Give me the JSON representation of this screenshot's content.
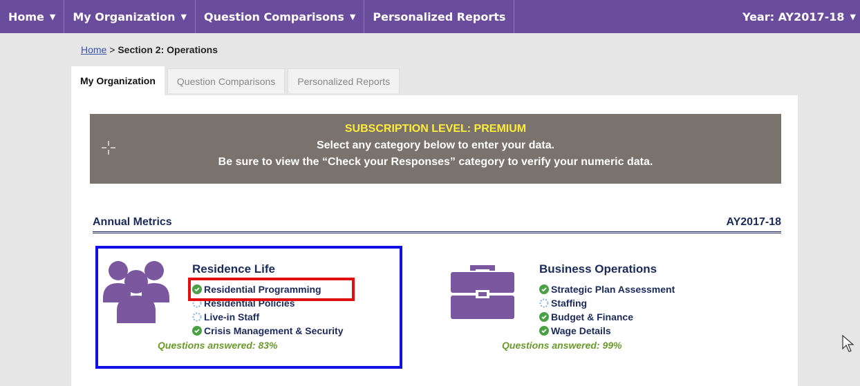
{
  "nav": {
    "home": "Home",
    "my_org": "My Organization",
    "question_comparisons": "Question Comparisons",
    "personalized_reports": "Personalized Reports",
    "year": "Year: AY2017-18"
  },
  "breadcrumb": {
    "home": "Home",
    "separator": ">",
    "current": "Section 2: Operations"
  },
  "tabs": [
    {
      "label": "My Organization",
      "active": true
    },
    {
      "label": "Question Comparisons",
      "active": false
    },
    {
      "label": "Personalized Reports",
      "active": false
    }
  ],
  "banner": {
    "level": "SUBSCRIPTION LEVEL: PREMIUM",
    "line1": "Select any category below to enter your data.",
    "line2": "Be sure to view the “Check your Responses” category to verify your numeric data."
  },
  "metrics": {
    "title": "Annual Metrics",
    "year": "AY2017-18"
  },
  "categories": [
    {
      "title": "Residence Life",
      "icon": "people-group-icon",
      "items": [
        {
          "label": "Residential Programming",
          "status": "complete"
        },
        {
          "label": "Residential Policies",
          "status": "in-progress"
        },
        {
          "label": "Live-in Staff",
          "status": "in-progress"
        },
        {
          "label": "Crisis Management & Security",
          "status": "complete"
        }
      ],
      "answered": "Questions answered: 83%"
    },
    {
      "title": "Business Operations",
      "icon": "briefcase-icon",
      "items": [
        {
          "label": "Strategic Plan Assessment",
          "status": "complete"
        },
        {
          "label": "Staffing",
          "status": "in-progress"
        },
        {
          "label": "Budget & Finance",
          "status": "complete"
        },
        {
          "label": "Wage Details",
          "status": "complete"
        }
      ],
      "answered": "Questions answered: 99%"
    }
  ],
  "colors": {
    "nav_bg": "#6a4c9c",
    "banner_bg": "#79726d",
    "level_text": "#ffec3d",
    "icon_purple": "#7b579f",
    "check_green": "#4aa045",
    "selection_blue": "#1010e6",
    "highlight_red": "#e01010"
  }
}
